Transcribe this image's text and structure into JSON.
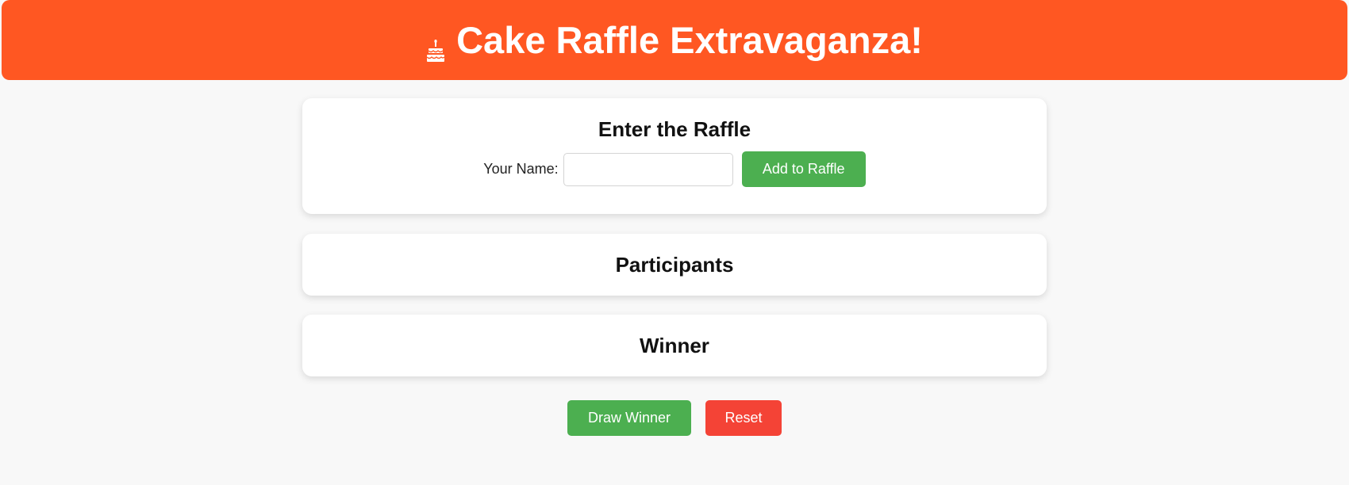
{
  "header": {
    "title": "Cake Raffle Extravaganza!",
    "icon": "cake-icon",
    "background_color": "#ff5722"
  },
  "entry": {
    "title": "Enter the Raffle",
    "name_label": "Your Name:",
    "name_value": "",
    "add_button": "Add to Raffle"
  },
  "participants": {
    "title": "Participants",
    "items": []
  },
  "winner": {
    "title": "Winner",
    "value": ""
  },
  "actions": {
    "draw_button": "Draw Winner",
    "reset_button": "Reset"
  },
  "colors": {
    "primary_button": "#4caf50",
    "danger_button": "#f44336",
    "page_background": "#f8f8f8"
  }
}
